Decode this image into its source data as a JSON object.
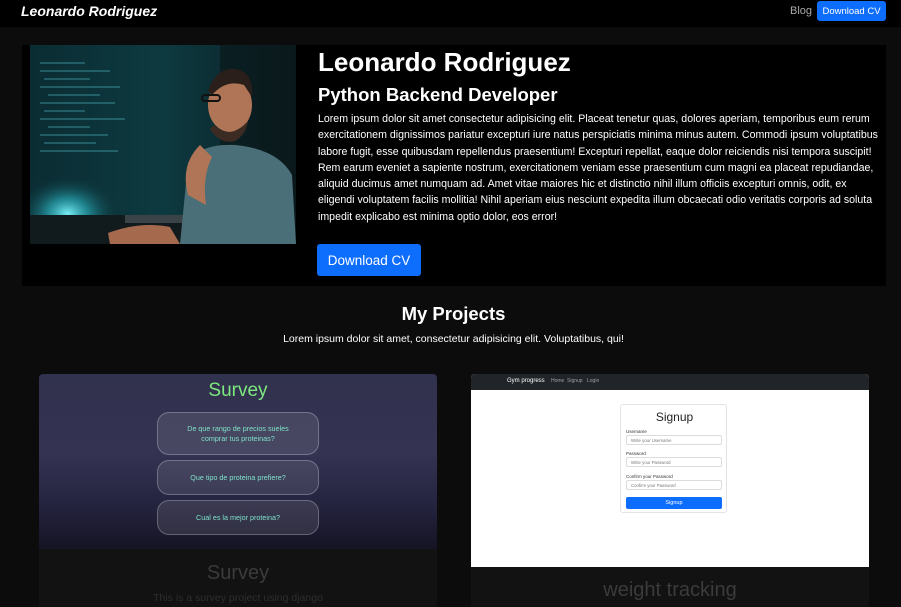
{
  "navbar": {
    "brand": "Leonardo Rodriguez",
    "blog_label": "Blog",
    "cv_button": "Download CV"
  },
  "hero": {
    "name": "Leonardo Rodriguez",
    "role": "Python Backend Developer",
    "bio": "Lorem ipsum dolor sit amet consectetur adipisicing elit. Placeat tenetur quas, dolores aperiam, temporibus eum rerum exercitationem dignissimos pariatur excepturi iure natus perspiciatis minima minus autem. Commodi ipsum voluptatibus labore fugit, esse quibusdam repellendus praesentium! Excepturi repellat, eaque dolor reiciendis nisi tempora suscipit! Rem earum eveniet a sapiente nostrum, exercitationem veniam esse praesentium cum magni ea placeat repudiandae, aliquid ducimus amet numquam ad. Amet vitae maiores hic et distinctio nihil illum officiis excepturi omnis, odit, ex eligendi voluptatem facilis mollitia! Nihil aperiam eius nesciunt expedita illum obcaecati odio veritatis corporis ad soluta impedit explicabo est minima optio dolor, eos error!",
    "download_button": "Download CV"
  },
  "projects": {
    "title": "My Projects",
    "subtitle": "Lorem ipsum dolor sit amet, consectetur adipisicing elit. Voluptatibus, qui!",
    "items": [
      {
        "title": "Survey",
        "description": "This is a survey project using django",
        "screenshot": {
          "title": "Survey",
          "questions": [
            "De que rango de precios sueles comprar tus proteinas?",
            "Que tipo de proteina prefiere?",
            "Cual es la mejor proteina?"
          ]
        }
      },
      {
        "title": "weight tracking",
        "screenshot": {
          "brand": "Gym progress",
          "links": [
            "Home",
            "Signup",
            "Login"
          ],
          "form_title": "Signup",
          "fields": [
            {
              "label": "Username",
              "placeholder": "Write your Username"
            },
            {
              "label": "Password",
              "placeholder": "Write your Password"
            },
            {
              "label": "Confirm your Password",
              "placeholder": "Confirm your Password"
            }
          ],
          "submit": "Signup"
        }
      }
    ]
  },
  "colors": {
    "accent": "#0d6efd",
    "page_bg": "#0c0c0c",
    "survey_green": "#7de87f"
  }
}
